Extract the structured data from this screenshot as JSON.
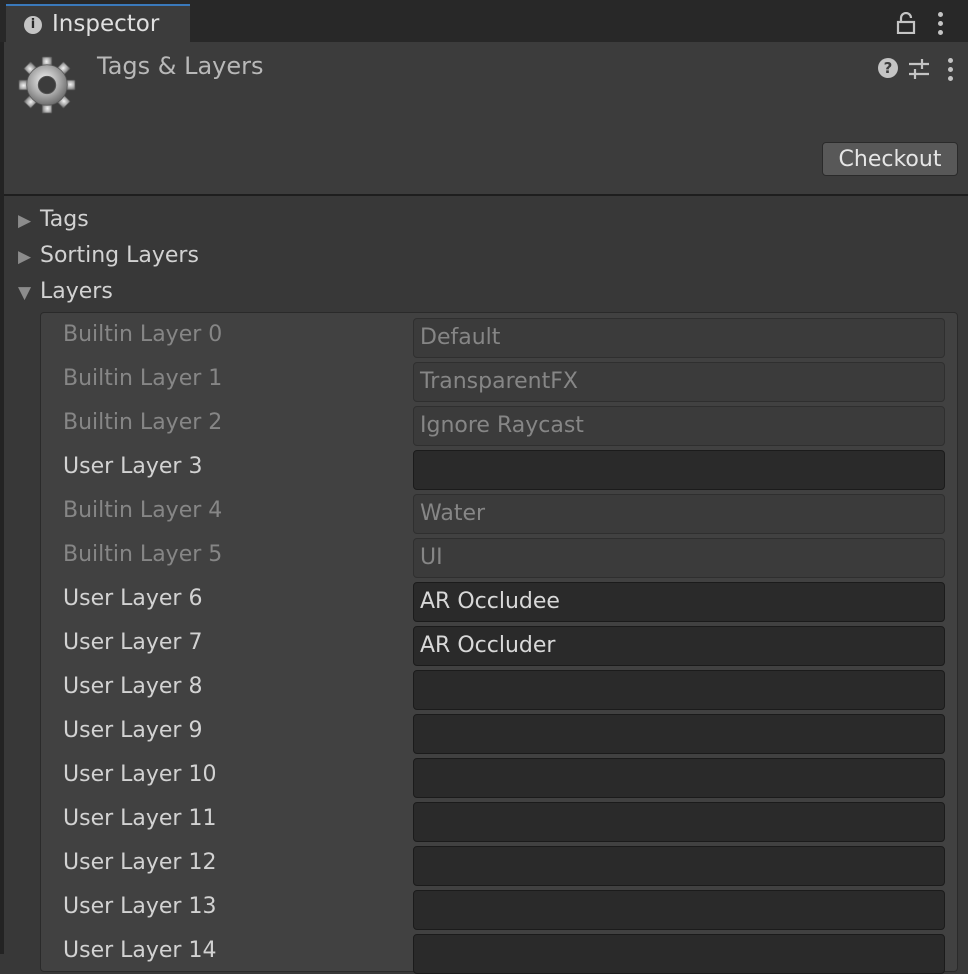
{
  "tab": {
    "label": "Inspector"
  },
  "header": {
    "title": "Tags & Layers",
    "checkout_label": "Checkout"
  },
  "sections": [
    {
      "label": "Tags",
      "expanded": false
    },
    {
      "label": "Sorting Layers",
      "expanded": false
    },
    {
      "label": "Layers",
      "expanded": true
    }
  ],
  "layers": [
    {
      "label": "Builtin Layer 0",
      "value": "Default",
      "builtin": true
    },
    {
      "label": "Builtin Layer 1",
      "value": "TransparentFX",
      "builtin": true
    },
    {
      "label": "Builtin Layer 2",
      "value": "Ignore Raycast",
      "builtin": true
    },
    {
      "label": "User Layer 3",
      "value": "",
      "builtin": false
    },
    {
      "label": "Builtin Layer 4",
      "value": "Water",
      "builtin": true
    },
    {
      "label": "Builtin Layer 5",
      "value": "UI",
      "builtin": true
    },
    {
      "label": "User Layer 6",
      "value": "AR Occludee",
      "builtin": false
    },
    {
      "label": "User Layer 7",
      "value": "AR Occluder",
      "builtin": false
    },
    {
      "label": "User Layer 8",
      "value": "",
      "builtin": false
    },
    {
      "label": "User Layer 9",
      "value": "",
      "builtin": false
    },
    {
      "label": "User Layer 10",
      "value": "",
      "builtin": false
    },
    {
      "label": "User Layer 11",
      "value": "",
      "builtin": false
    },
    {
      "label": "User Layer 12",
      "value": "",
      "builtin": false
    },
    {
      "label": "User Layer 13",
      "value": "",
      "builtin": false
    },
    {
      "label": "User Layer 14",
      "value": "",
      "builtin": false
    }
  ],
  "icons": {
    "tab": "info-icon",
    "lock": "lock-icon",
    "header": "gear-icon",
    "help": "help-icon",
    "settings": "settings-icon",
    "more": "kebab-menu-icon"
  },
  "colors": {
    "tab_accent": "#3a79bb",
    "panel_bg": "#383838"
  }
}
